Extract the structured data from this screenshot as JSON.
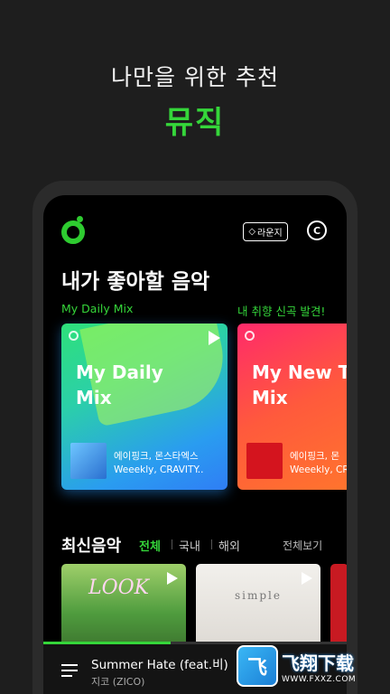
{
  "promo": {
    "line1": "나만을 위한 추천",
    "line2": "뮤직"
  },
  "header": {
    "lounge_label": "라운지",
    "c_label": "C"
  },
  "section1": {
    "title": "내가 좋아할 음악",
    "cards": [
      {
        "label": "My Daily Mix",
        "title": "My Daily\nMix",
        "artists_line1": "에이핑크, 몬스타엑스",
        "artists_line2": "Weeekly, CRAVITY.."
      },
      {
        "label": "내 취향 신곡 발견!",
        "title": "My New Tr\nMix",
        "artists_line1": "에이핑크, 몬",
        "artists_line2": "Weeekly, CR"
      }
    ]
  },
  "section2": {
    "title": "최신음악",
    "tabs": [
      "전체",
      "국내",
      "해외"
    ],
    "see_all": "전체보기",
    "albums": [
      {
        "art_text": "LOOK"
      },
      {
        "art_text": "simple"
      }
    ]
  },
  "player": {
    "title": "Summer Hate (feat.비)",
    "artist": "지코 (ZICO)",
    "progress": 0.42
  },
  "watermark": {
    "logo": "飞",
    "text": "飞翔下载",
    "url": "WWW.FXXZ.COM"
  },
  "colors": {
    "accent": "#35d63a",
    "background": "#1e1e1e"
  }
}
